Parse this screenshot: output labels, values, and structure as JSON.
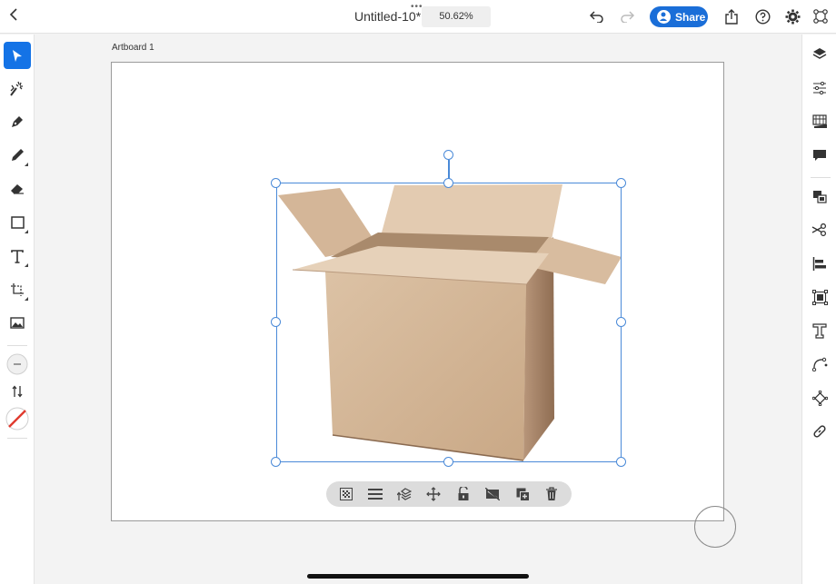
{
  "topbar": {
    "back_icon": "chevron-left-icon",
    "more_icon": "ellipsis-icon",
    "more_text": "•••",
    "title": "Untitled-10*",
    "zoom": "50.62%",
    "undo_icon": "undo-icon",
    "redo_icon": "redo-icon",
    "share_label": "Share",
    "export_icon": "share-upload-icon",
    "help_icon": "help-icon",
    "settings_icon": "gear-icon",
    "preview_icon": "preview-icon"
  },
  "canvas": {
    "artboard_label": "Artboard 1",
    "image_subject": "open cardboard box"
  },
  "left_tools": [
    {
      "name": "select",
      "icon": "arrow-pointer-icon",
      "active": true
    },
    {
      "name": "quick-select",
      "icon": "magic-wand-icon"
    },
    {
      "name": "pen",
      "icon": "pen-nib-icon"
    },
    {
      "name": "pencil",
      "icon": "pencil-icon"
    },
    {
      "name": "eraser",
      "icon": "eraser-icon"
    },
    {
      "name": "rectangle",
      "icon": "rectangle-icon"
    },
    {
      "name": "text",
      "icon": "text-icon"
    },
    {
      "name": "transform",
      "icon": "transform-icon"
    },
    {
      "name": "place-image",
      "icon": "image-icon"
    }
  ],
  "left_extras": {
    "stroke_width_icon": "minus-circle-icon",
    "swap_icon": "swap-arrows-icon",
    "fill_icon": "no-fill-swatch-icon",
    "fill_color": "#e03a2e"
  },
  "right_panel": [
    "layers-icon",
    "properties-icon",
    "libraries-icon",
    "comments-icon",
    "arrange-icon",
    "cut-icon",
    "align-icon",
    "image-trace-icon",
    "type-icon",
    "path-icon",
    "pattern-icon",
    "link-icon"
  ],
  "context_bar": [
    "transparency-icon",
    "menu-lines-icon",
    "arrange-layers-icon",
    "move-icon",
    "unlock-icon",
    "hide-icon",
    "duplicate-icon",
    "trash-icon"
  ],
  "colors": {
    "accent": "#1473e6",
    "share": "#1a6ed8",
    "selection": "#4a8ad8",
    "box": "#d6b896"
  }
}
